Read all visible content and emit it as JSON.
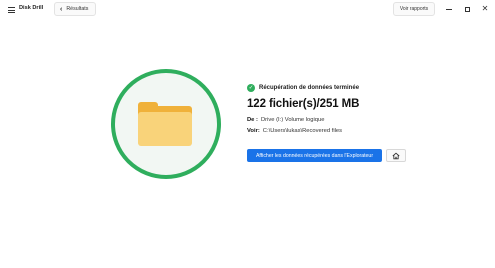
{
  "app": {
    "title": "Disk Drill"
  },
  "header": {
    "back_label": "Résultats",
    "reports_label": "Voir rapports"
  },
  "icons": {
    "menu": "menu-icon",
    "back": "chevron-left-icon",
    "folder": "folder-icon",
    "check": "check-circle-icon",
    "home": "home-icon",
    "minimize": "minimize-icon",
    "maximize": "maximize-icon",
    "close": "close-icon"
  },
  "colors": {
    "accent": "#1a73e8",
    "success": "#2fae5d",
    "folder": "#f9d37a"
  },
  "result": {
    "status": "Récupération de données terminée",
    "summary": "122 fichier(s)/251 MB",
    "from_label": "De :",
    "from_value": "Drive (I:) Volume logique",
    "path_label": "Voir:",
    "path_value": "C:\\Users\\lukas\\Recovered files",
    "explorer_button": "Afficher les données récupérées dans l'Explorateur"
  }
}
